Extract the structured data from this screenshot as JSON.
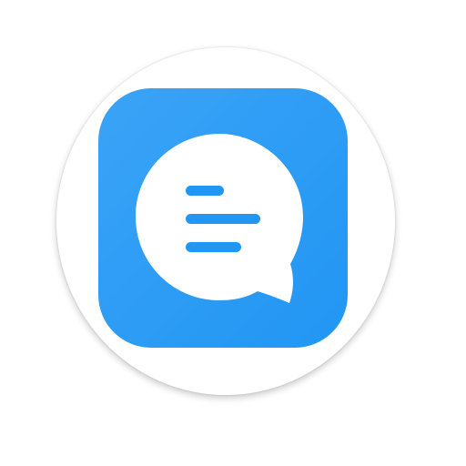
{
  "app_icon": {
    "icon": "chat-bubble-icon",
    "colors": {
      "tile": "#2196F3",
      "tile_highlight": "#3AA3F7",
      "bubble": "#FFFFFF",
      "lines": "#2196F3"
    }
  }
}
